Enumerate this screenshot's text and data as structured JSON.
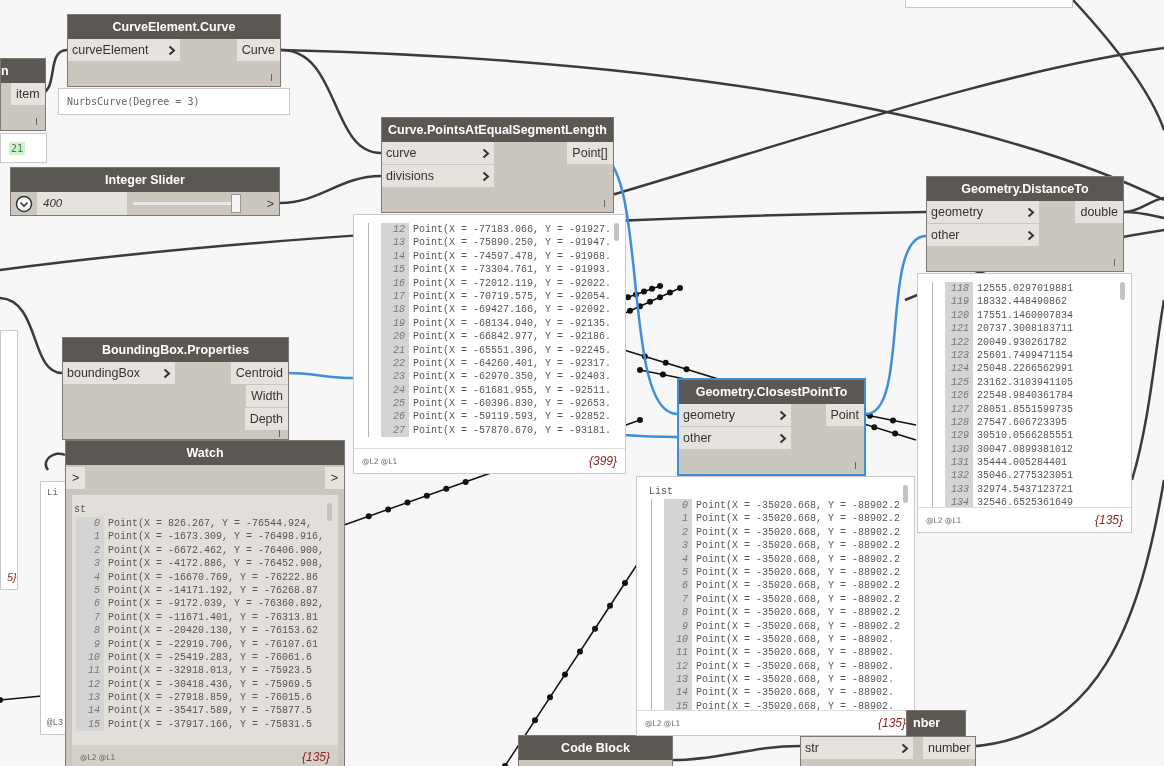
{
  "nodes": [
    {
      "kind": "node",
      "title": "n",
      "selected": false,
      "outputs": [
        "item"
      ]
    },
    {
      "kind": "node",
      "title": "CurveElement.Curve",
      "selected": false,
      "inputs": [
        "curveElement"
      ],
      "outputs": [
        "Curve"
      ]
    },
    {
      "kind": "slider",
      "title": "Integer Slider",
      "selected": false,
      "value": "400",
      "level": 0.97,
      "outputs": [
        ">"
      ]
    },
    {
      "kind": "node",
      "title": "Curve.PointsAtEqualSegmentLength",
      "selected": false,
      "inputs": [
        "curve",
        "divisions"
      ],
      "outputs": [
        "Point[]"
      ]
    },
    {
      "kind": "node",
      "title": "Geometry.DistanceTo",
      "selected": false,
      "inputs": [
        "geometry",
        "other"
      ],
      "outputs": [
        "double"
      ]
    },
    {
      "kind": "node",
      "title": "BoundingBox.Properties",
      "selected": false,
      "inputs": [
        "boundingBox"
      ],
      "outputs": [
        "Centroid",
        "Width",
        "Depth"
      ]
    },
    {
      "kind": "watch",
      "title": "Watch",
      "selected": false,
      "inputs": [
        ">"
      ],
      "outputs": [
        ">"
      ],
      "preview": {
        "header": "st",
        "levels": "@L2 @L1",
        "count": "{135}",
        "rows": [
          {
            "index": "0",
            "value": "Point(X = 826.267, Y = -76544.924,"
          },
          {
            "index": "1",
            "value": "Point(X = -1673.309, Y = -76498.916,"
          },
          {
            "index": "2",
            "value": "Point(X = -6672.462, Y = -76406.900,"
          },
          {
            "index": "3",
            "value": "Point(X = -4172.886, Y = -76452.908,"
          },
          {
            "index": "4",
            "value": "Point(X = -16670.769, Y = -76222.86"
          },
          {
            "index": "5",
            "value": "Point(X = -14171.192, Y = -76268.87"
          },
          {
            "index": "6",
            "value": "Point(X = -9172.039, Y = -76360.892,"
          },
          {
            "index": "7",
            "value": "Point(X = -11671.401, Y = -76313.81"
          },
          {
            "index": "8",
            "value": "Point(X = -20420.130, Y = -76153.62"
          },
          {
            "index": "9",
            "value": "Point(X = -22919.706, Y = -76107.61"
          },
          {
            "index": "10",
            "value": "Point(X = -25419.283, Y = -76061.6"
          },
          {
            "index": "11",
            "value": "Point(X = -32918.013, Y = -75923.5"
          },
          {
            "index": "12",
            "value": "Point(X = -30418.436, Y = -75969.5"
          },
          {
            "index": "13",
            "value": "Point(X = -27918.859, Y = -76015.6"
          },
          {
            "index": "14",
            "value": "Point(X = -35417.589, Y = -75877.5"
          },
          {
            "index": "15",
            "value": "Point(X = -37917.166, Y = -75831.5"
          }
        ]
      }
    },
    {
      "kind": "node",
      "title": "Geometry.ClosestPointTo",
      "selected": true,
      "inputs": [
        "geometry",
        "other"
      ],
      "outputs": [
        "Point"
      ]
    },
    {
      "kind": "node",
      "title": "Code Block",
      "selected": false
    },
    {
      "kind": "node",
      "title": "nber",
      "selected": false,
      "inputs": [
        "str"
      ],
      "outputs": [
        "number"
      ]
    }
  ],
  "previews": [
    {
      "kind": "value",
      "text": "21",
      "highlighted": true
    },
    {
      "kind": "value",
      "text": "NurbsCurve(Degree = 3)",
      "highlighted": false
    },
    {
      "kind": "list",
      "levels": "@L2 @L1",
      "count": "{399}",
      "rows": [
        {
          "index": "12",
          "value": "Point(X = -77183.066, Y = -91927."
        },
        {
          "index": "13",
          "value": "Point(X = -75890.250, Y = -91947."
        },
        {
          "index": "14",
          "value": "Point(X = -74597.478, Y = -91968."
        },
        {
          "index": "15",
          "value": "Point(X = -73304.761, Y = -91993."
        },
        {
          "index": "16",
          "value": "Point(X = -72012.119, Y = -92022."
        },
        {
          "index": "17",
          "value": "Point(X = -70719.575, Y = -92054."
        },
        {
          "index": "18",
          "value": "Point(X = -69427.166, Y = -92092."
        },
        {
          "index": "19",
          "value": "Point(X = -68134.940, Y = -92135."
        },
        {
          "index": "20",
          "value": "Point(X = -66842.977, Y = -92186."
        },
        {
          "index": "21",
          "value": "Point(X = -65551.396, Y = -92245."
        },
        {
          "index": "22",
          "value": "Point(X = -64260.401, Y = -92317."
        },
        {
          "index": "23",
          "value": "Point(X = -62970.350, Y = -92403."
        },
        {
          "index": "24",
          "value": "Point(X = -61681.955, Y = -92511."
        },
        {
          "index": "25",
          "value": "Point(X = -60396.830, Y = -92653."
        },
        {
          "index": "26",
          "value": "Point(X = -59119.593, Y = -92852."
        },
        {
          "index": "27",
          "value": "Point(X = -57870.670, Y = -93181."
        }
      ]
    },
    {
      "kind": "list",
      "levels": "@L2 @L1",
      "count": "{135}",
      "rows": [
        {
          "index": "118",
          "value": "12555.0297019881"
        },
        {
          "index": "119",
          "value": "18332.448490862"
        },
        {
          "index": "120",
          "value": "17551.1460007834"
        },
        {
          "index": "121",
          "value": "20737.3008183711"
        },
        {
          "index": "122",
          "value": "20049.930261782"
        },
        {
          "index": "123",
          "value": "25601.7499471154"
        },
        {
          "index": "124",
          "value": "25048.2266562991"
        },
        {
          "index": "125",
          "value": "23162.3103941105"
        },
        {
          "index": "126",
          "value": "22548.9840361784"
        },
        {
          "index": "127",
          "value": "28051.8551599735"
        },
        {
          "index": "128",
          "value": "27547.606723395"
        },
        {
          "index": "129",
          "value": "30510.0566285551"
        },
        {
          "index": "130",
          "value": "30047.0899381012"
        },
        {
          "index": "131",
          "value": "35444.005284401"
        },
        {
          "index": "132",
          "value": "35046.2775323051"
        },
        {
          "index": "133",
          "value": "32974.5437123721"
        },
        {
          "index": "134",
          "value": "32546.6525361649"
        }
      ]
    },
    {
      "kind": "list",
      "header": "List",
      "levels": "@L2 @L1",
      "count": "{135}",
      "rows": [
        {
          "index": "0",
          "value": "Point(X = -35020.668, Y = -88902.2"
        },
        {
          "index": "1",
          "value": "Point(X = -35020.668, Y = -88902.2"
        },
        {
          "index": "2",
          "value": "Point(X = -35020.668, Y = -88902.2"
        },
        {
          "index": "3",
          "value": "Point(X = -35020.668, Y = -88902.2"
        },
        {
          "index": "4",
          "value": "Point(X = -35020.668, Y = -88902.2"
        },
        {
          "index": "5",
          "value": "Point(X = -35020.668, Y = -88902.2"
        },
        {
          "index": "6",
          "value": "Point(X = -35020.668, Y = -88902.2"
        },
        {
          "index": "7",
          "value": "Point(X = -35020.668, Y = -88902.2"
        },
        {
          "index": "8",
          "value": "Point(X = -35020.668, Y = -88902.2"
        },
        {
          "index": "9",
          "value": "Point(X = -35020.668, Y = -88902.2"
        },
        {
          "index": "10",
          "value": "Point(X = -35020.668, Y = -88902."
        },
        {
          "index": "11",
          "value": "Point(X = -35020.668, Y = -88902."
        },
        {
          "index": "12",
          "value": "Point(X = -35020.668, Y = -88902."
        },
        {
          "index": "13",
          "value": "Point(X = -35020.668, Y = -88902."
        },
        {
          "index": "14",
          "value": "Point(X = -35020.668, Y = -88902."
        },
        {
          "index": "15",
          "value": "Point(X = -35020.668, Y = -88902."
        }
      ]
    },
    {
      "kind": "stub",
      "texts": [
        "5}"
      ]
    },
    {
      "kind": "stub",
      "texts": [
        "Li",
        "@L3"
      ]
    },
    {
      "kind": "stub"
    }
  ]
}
